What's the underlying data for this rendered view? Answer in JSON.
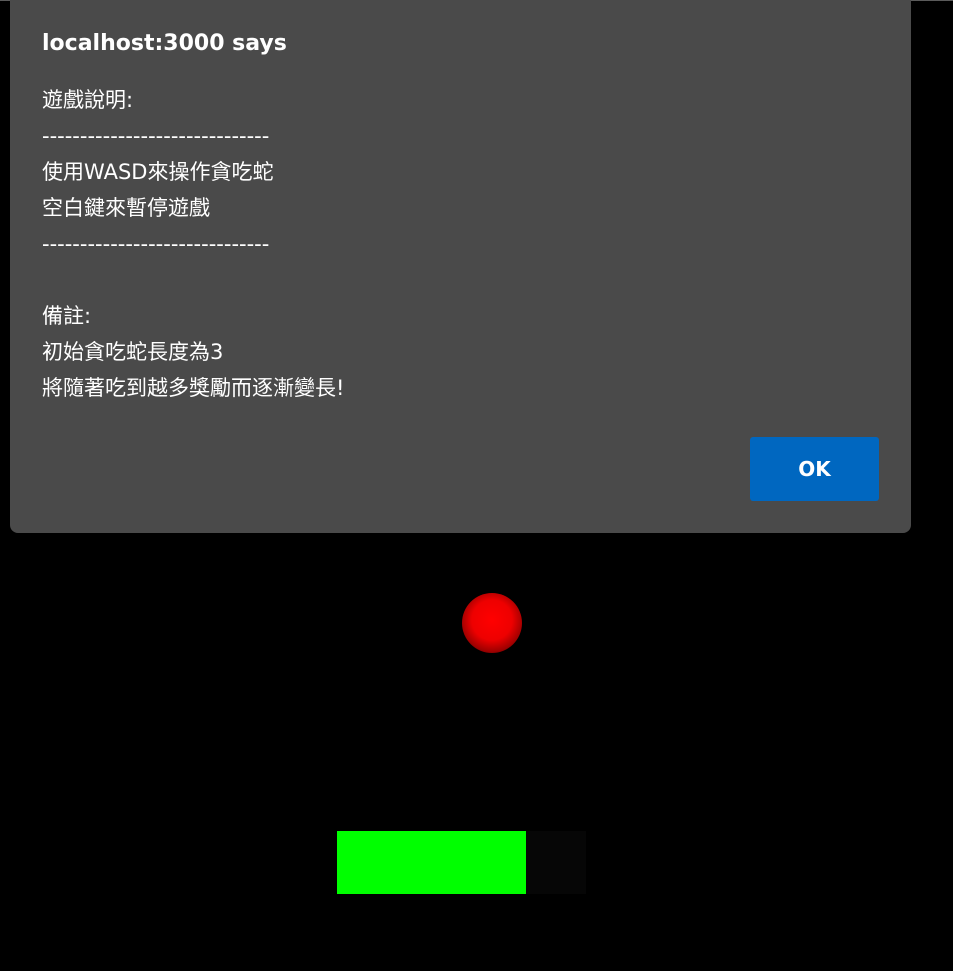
{
  "dialog": {
    "title": "localhost:3000 says",
    "message_lines": [
      "遊戲說明:",
      "------------------------------",
      "使用WASD來操作貪吃蛇",
      "空白鍵來暫停遊戲",
      "------------------------------",
      "",
      "備註:",
      "初始貪吃蛇長度為3",
      "將隨著吃到越多獎勵而逐漸變長!"
    ],
    "ok_label": "OK"
  },
  "game": {
    "background_color": "#000000",
    "food_color": "#ff0000",
    "snake_color": "#00ff00",
    "snake_length": 3,
    "food_icon": "apple-orb"
  },
  "colors": {
    "dialog_bg": "#4a4a4a",
    "button_bg": "#0067c0",
    "text": "#ffffff"
  }
}
